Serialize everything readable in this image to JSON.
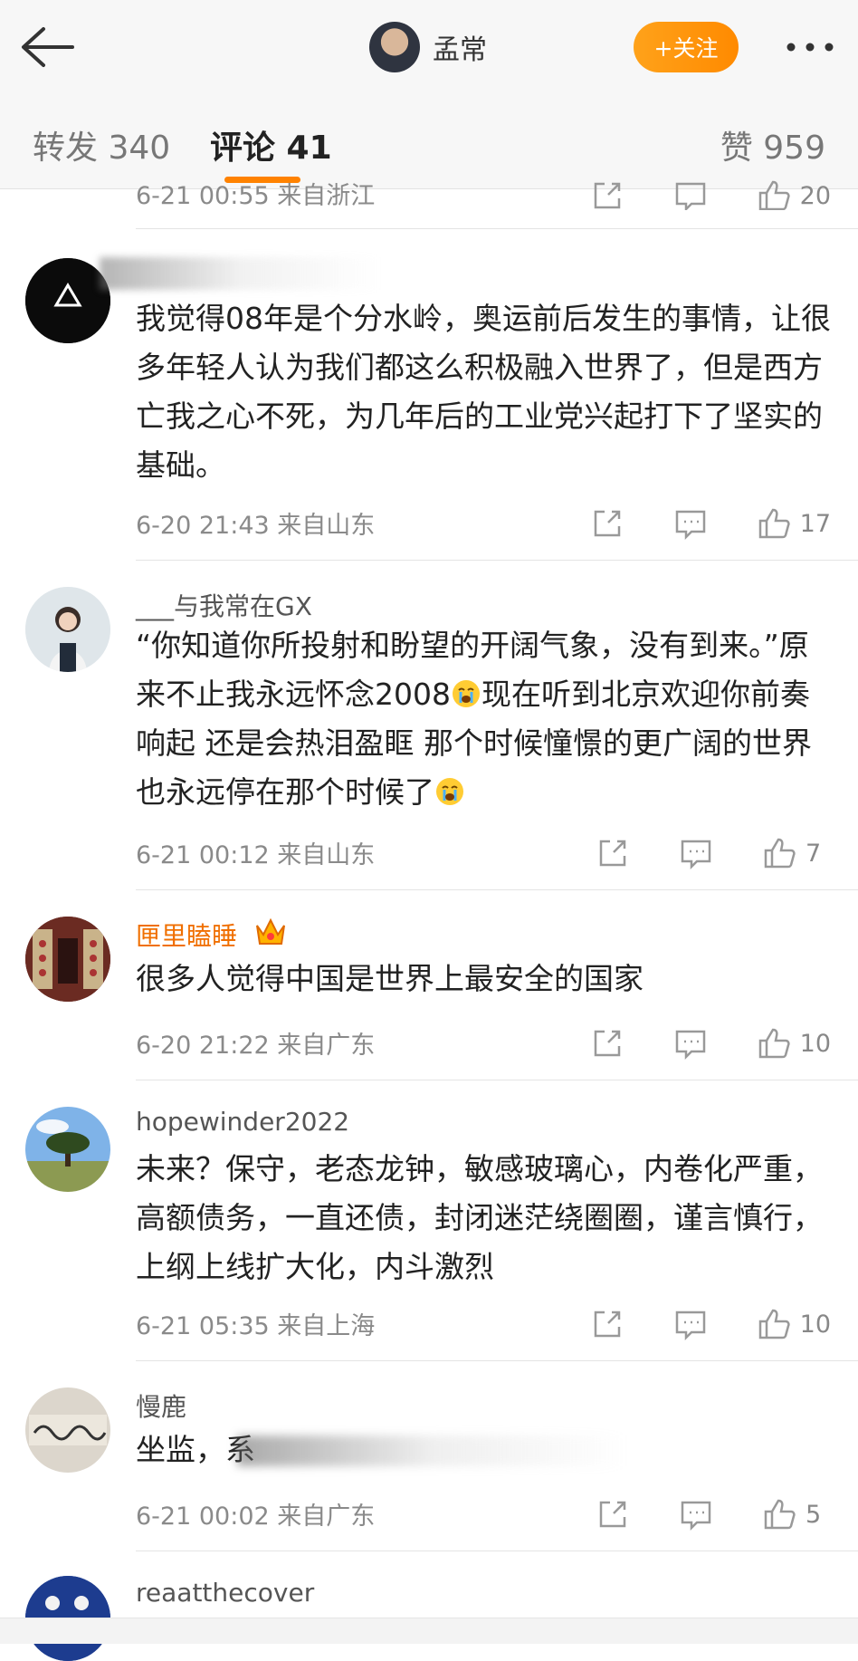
{
  "header": {
    "author_name": "孟常",
    "follow_label": "+关注"
  },
  "tabs": {
    "repost": "转发 340",
    "comments": "评论 41",
    "likes": "赞 959"
  },
  "partial_row": {
    "meta": "6-21 00:55 来自浙江",
    "likes": "20"
  },
  "comments": [
    {
      "username": "",
      "text": "我觉得08年是个分水岭，奥运前后发生的事情，让很多年轻人认为我们都这么积极融入世界了，但是西方亡我之心不死，为几年后的工业党兴起打下了坚实的基础。",
      "meta": "6-20 21:43 来自山东",
      "likes": "17"
    },
    {
      "username": "___与我常在GX",
      "text_part1": "“你知道你所投射和盼望的开阔气象，没有到来。”原来不止我永远怀念2008",
      "text_part2": "现在听到北京欢迎你前奏响起 还是会热泪盈眶 那个时候憧憬的更广阔的世界 也永远停在那个时候了",
      "meta": "6-21 00:12 来自山东",
      "likes": "7"
    },
    {
      "username": "匣里瞌睡",
      "text": "很多人觉得中国是世界上最安全的国家",
      "meta": "6-20 21:22 来自广东",
      "likes": "10"
    },
    {
      "username": "hopewinder2022",
      "text": "未来？保守，老态龙钟，敏感玻璃心，内卷化严重，高额债务，一直还债，封闭迷茫绕圈圈，谨言慎行，上纲上线扩大化，内斗激烈",
      "meta": "6-21 05:35 来自上海",
      "likes": "10"
    },
    {
      "username": "慢鹿",
      "text": "坐监，系",
      "meta": "6-21 00:02 来自广东",
      "likes": "5"
    },
    {
      "username": "reaatthecover"
    }
  ],
  "colors": {
    "accent_orange": "#ff8200",
    "vip_name": "#f06f00",
    "meta_gray": "#8a8a8a"
  },
  "icons": [
    "back-arrow-icon",
    "more-icon",
    "share-icon",
    "reply-icon",
    "like-icon",
    "crown-icon",
    "crying-emoji-icon"
  ]
}
